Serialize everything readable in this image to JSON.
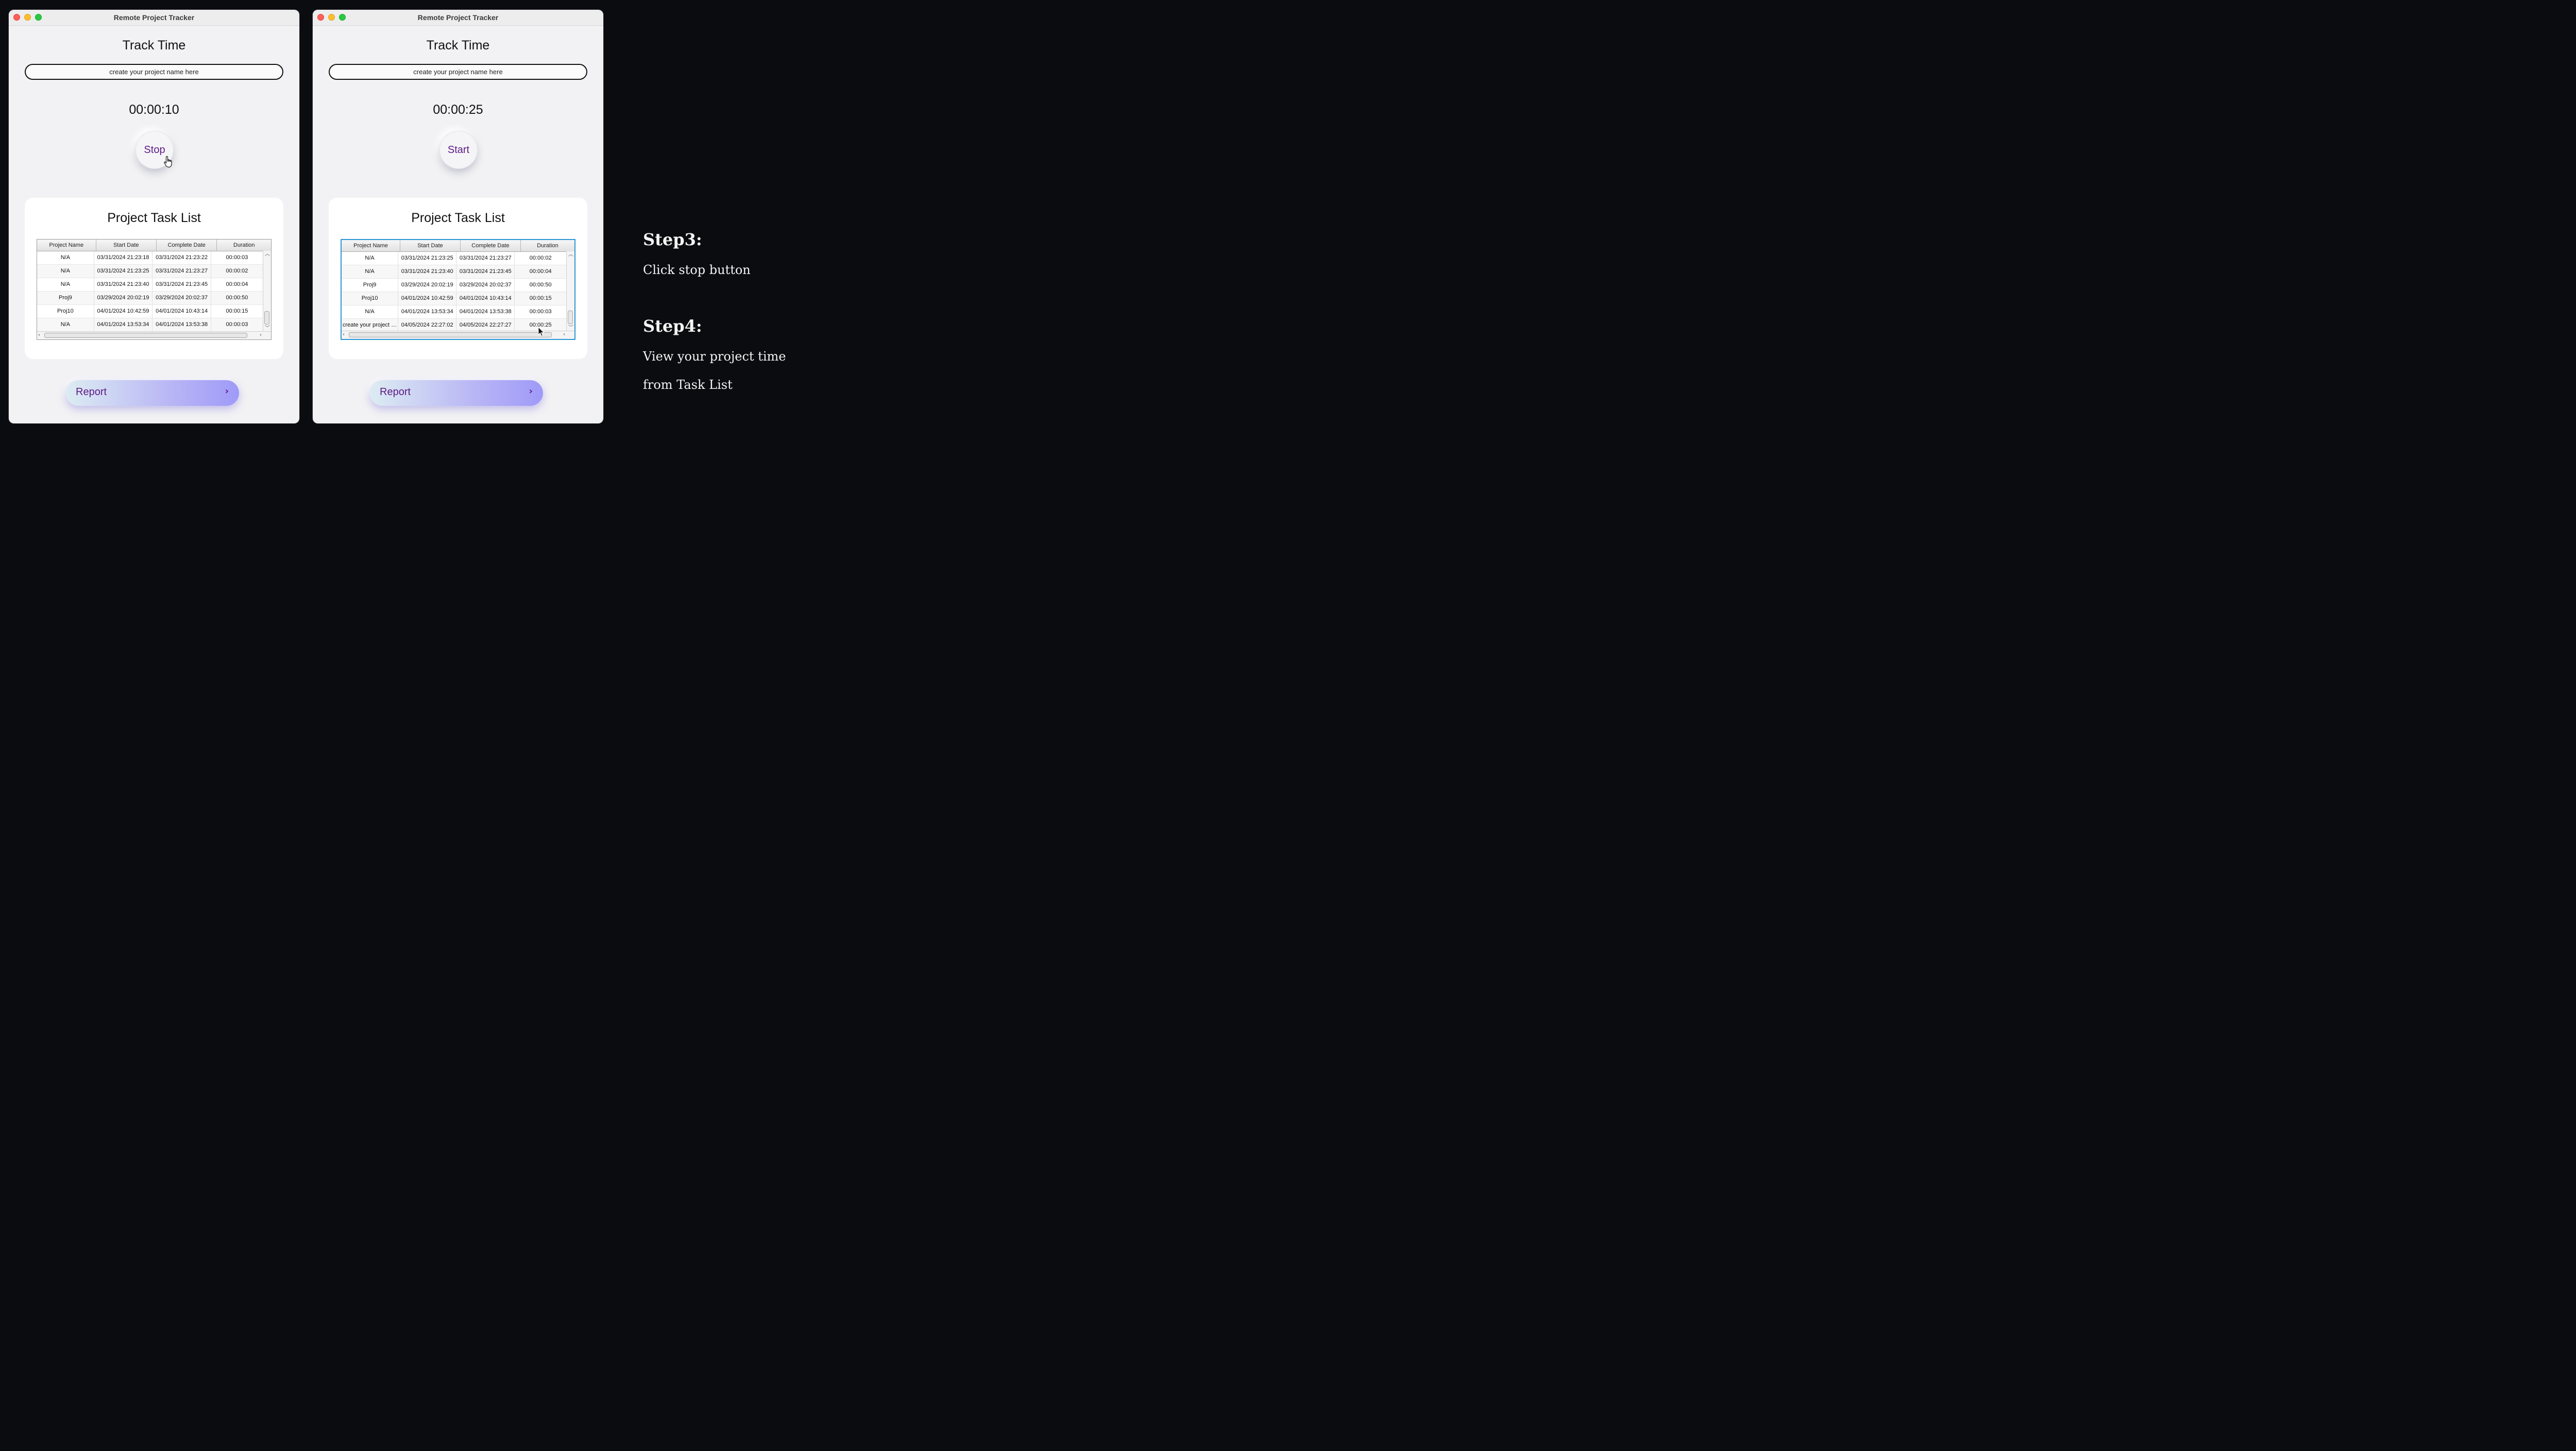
{
  "app": {
    "window_title": "Remote Project Tracker",
    "track_title": "Track Time",
    "project_placeholder": "create your project name here",
    "task_list_title": "Project Task List",
    "report_label": "Report",
    "chevron": "›"
  },
  "table_headers": [
    "Project Name",
    "Start Date",
    "Complete Date",
    "Duration"
  ],
  "left_window": {
    "timer": "00:00:10",
    "button_label": "Stop",
    "rows": [
      [
        "N/A",
        "03/31/2024 21:23:18",
        "03/31/2024 21:23:22",
        "00:00:03"
      ],
      [
        "N/A",
        "03/31/2024 21:23:25",
        "03/31/2024 21:23:27",
        "00:00:02"
      ],
      [
        "N/A",
        "03/31/2024 21:23:40",
        "03/31/2024 21:23:45",
        "00:00:04"
      ],
      [
        "Proj9",
        "03/29/2024 20:02:19",
        "03/29/2024 20:02:37",
        "00:00:50"
      ],
      [
        "Proj10",
        "04/01/2024 10:42:59",
        "04/01/2024 10:43:14",
        "00:00:15"
      ],
      [
        "N/A",
        "04/01/2024 13:53:34",
        "04/01/2024 13:53:38",
        "00:00:03"
      ]
    ]
  },
  "right_window": {
    "timer": "00:00:25",
    "button_label": "Start",
    "rows": [
      [
        "N/A",
        "03/31/2024 21:23:25",
        "03/31/2024 21:23:27",
        "00:00:02"
      ],
      [
        "N/A",
        "03/31/2024 21:23:40",
        "03/31/2024 21:23:45",
        "00:00:04"
      ],
      [
        "Proj9",
        "03/29/2024 20:02:19",
        "03/29/2024 20:02:37",
        "00:00:50"
      ],
      [
        "Proj10",
        "04/01/2024 10:42:59",
        "04/01/2024 10:43:14",
        "00:00:15"
      ],
      [
        "N/A",
        "04/01/2024 13:53:34",
        "04/01/2024 13:53:38",
        "00:00:03"
      ],
      [
        "create your project na...",
        "04/05/2024 22:27:02",
        "04/05/2024 22:27:27",
        "00:00:25"
      ]
    ]
  },
  "steps": {
    "step3_title": "Step3:",
    "step3_text": "Click stop button",
    "step4_title": "Step4:",
    "step4_line1": "View your project time",
    "step4_line2": "from Task List"
  },
  "icons": {
    "close": "close-icon",
    "minimize": "minimize-icon",
    "zoom": "zoom-icon",
    "report_chevron": "chevron-right-icon",
    "cursor_hand": "hand-cursor-icon",
    "cursor_arrow": "arrow-cursor-icon"
  },
  "colors": {
    "accent_text": "#5e1a86",
    "table_focus": "#2b97d6",
    "background": "#0b0c10"
  }
}
